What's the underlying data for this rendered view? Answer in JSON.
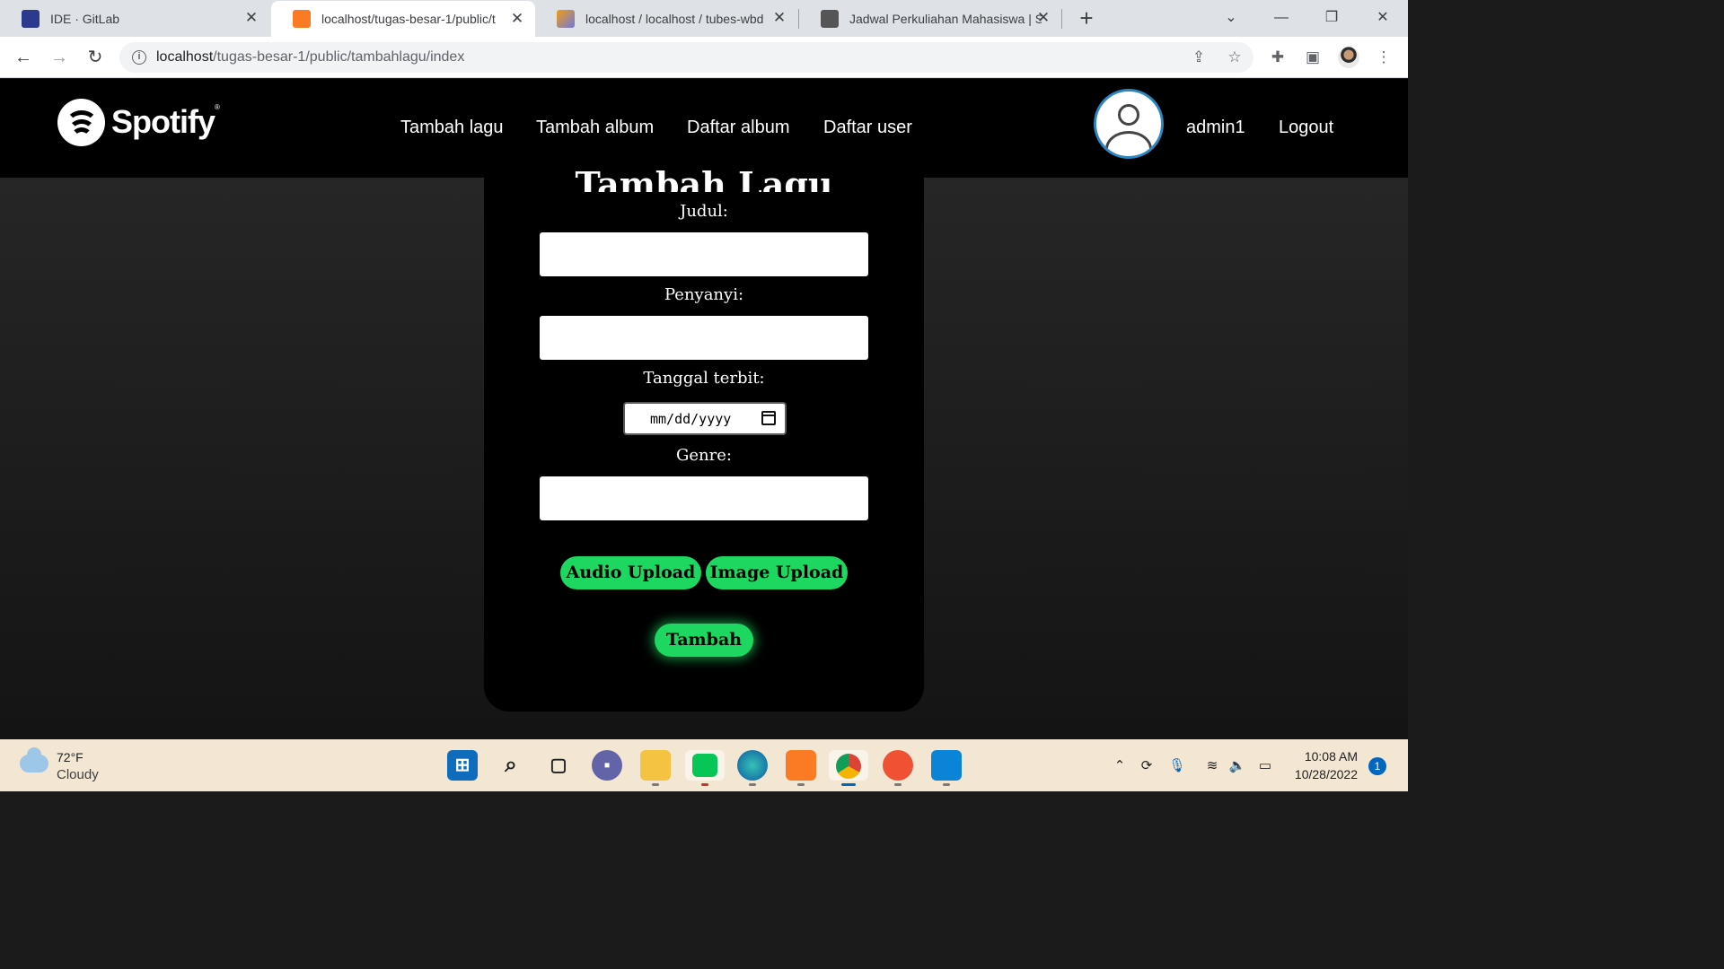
{
  "browser": {
    "tabs": [
      {
        "title": "IDE · GitLab",
        "icon": "gitlab-ide-icon",
        "active": false
      },
      {
        "title": "localhost/tugas-besar-1/public/t",
        "icon": "xampp-icon",
        "active": true
      },
      {
        "title": "localhost / localhost / tubes-wbd",
        "icon": "phpmyadmin-icon",
        "active": false
      },
      {
        "title": "Jadwal Perkuliahan Mahasiswa | S",
        "icon": "campus-icon",
        "active": false
      }
    ],
    "new_tab_label": "+",
    "url_host": "localhost",
    "url_path": "/tugas-besar-1/public/tambahlagu/index"
  },
  "site": {
    "brand": "Spotify",
    "brand_mark": "®",
    "nav": [
      "Tambah lagu",
      "Tambah album",
      "Daftar album",
      "Daftar user"
    ],
    "username": "admin1",
    "logout_label": "Logout"
  },
  "form": {
    "title": "Tambah Lagu",
    "judul_label": "Judul:",
    "penyanyi_label": "Penyanyi:",
    "tanggal_label": "Tanggal terbit:",
    "date_placeholder": "mm/dd/yyyy",
    "genre_label": "Genre:",
    "audio_upload_label": "Audio Upload",
    "image_upload_label": "Image Upload",
    "submit_label": "Tambah",
    "accent_color": "#1ed760"
  },
  "taskbar": {
    "temperature": "72°F",
    "weather": "Cloudy",
    "time": "10:08 AM",
    "date": "10/28/2022",
    "notifications": "1",
    "apps": [
      "start-icon",
      "search-icon",
      "task-view-icon",
      "chat-icon",
      "file-explorer-icon",
      "line-icon",
      "edge-icon",
      "xampp-icon",
      "chrome-icon",
      "git-icon",
      "vscode-icon"
    ]
  }
}
